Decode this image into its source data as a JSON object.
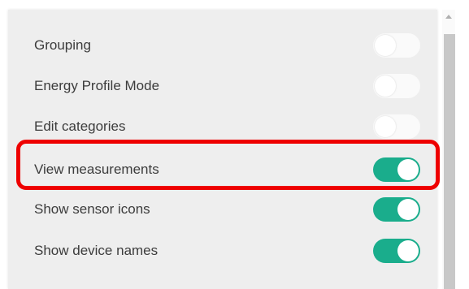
{
  "settings": {
    "items": [
      {
        "label": "Grouping",
        "enabled": false
      },
      {
        "label": "Energy Profile Mode",
        "enabled": false
      },
      {
        "label": "Edit categories",
        "enabled": false
      },
      {
        "label": "View measurements",
        "enabled": true
      },
      {
        "label": "Show sensor icons",
        "enabled": true
      },
      {
        "label": "Show device names",
        "enabled": true
      }
    ]
  },
  "colors": {
    "toggle_on": "#1aad8c",
    "toggle_off": "#fafafa",
    "highlight": "#ee0000",
    "panel_background": "#eeeeee"
  },
  "icons": {
    "scroll_up": "triangle-up-icon"
  }
}
